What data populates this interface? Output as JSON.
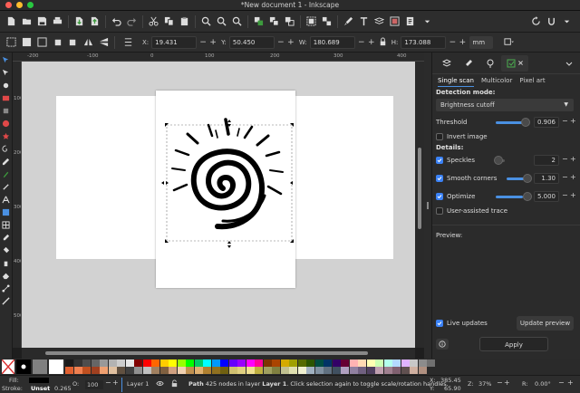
{
  "window": {
    "title": "*New document 1 - Inkscape"
  },
  "toolbar": {
    "x_label": "X:",
    "x_value": "19.431",
    "y_label": "Y:",
    "y_value": "50.450",
    "w_label": "W:",
    "w_value": "180.689",
    "h_label": "H:",
    "h_value": "173.088",
    "unit": "mm"
  },
  "rulers": {
    "h_ticks": [
      "-200",
      "-100",
      "0",
      "100",
      "200",
      "300",
      "400"
    ],
    "v_ticks": [
      "100",
      "200",
      "300",
      "400",
      "500"
    ]
  },
  "trace": {
    "tabs": [
      "Single scan",
      "Multicolor",
      "Pixel art"
    ],
    "detection_mode_label": "Detection mode:",
    "detection_mode_value": "Brightness cutoff",
    "threshold_label": "Threshold",
    "threshold_value": "0.906",
    "threshold_fraction": 0.906,
    "invert_label": "Invert image",
    "details_label": "Details:",
    "speckles_label": "Speckles",
    "speckles_value": "2",
    "smooth_label": "Smooth corners",
    "smooth_value": "1.30",
    "optimize_label": "Optimize",
    "optimize_value": "5.000",
    "user_assisted_label": "User-assisted trace",
    "preview_label": "Preview:",
    "live_updates_label": "Live updates",
    "update_preview_label": "Update preview",
    "apply_label": "Apply"
  },
  "status": {
    "fill_label": "Fill:",
    "stroke_label": "Stroke:",
    "stroke_value": "Unset",
    "stroke_width": "0.265",
    "opacity_label": "O:",
    "opacity_value": "100",
    "layer_name": "Layer 1",
    "message_bold": "Path",
    "message_rest": " 425 nodes in layer ",
    "message_layer": "Layer 1",
    "message_tail": ". Click selection again to toggle scale/rotation handles.",
    "x_label": "X:",
    "x_value": "385.45",
    "y_label": "Y:",
    "y_value": "65.90",
    "zoom_label": "Z:",
    "zoom_value": "37%",
    "rotation_label": "R:",
    "rotation_value": "0.00°"
  },
  "colors": {
    "accent": "#4a90e2",
    "check": "#3b82f6"
  }
}
